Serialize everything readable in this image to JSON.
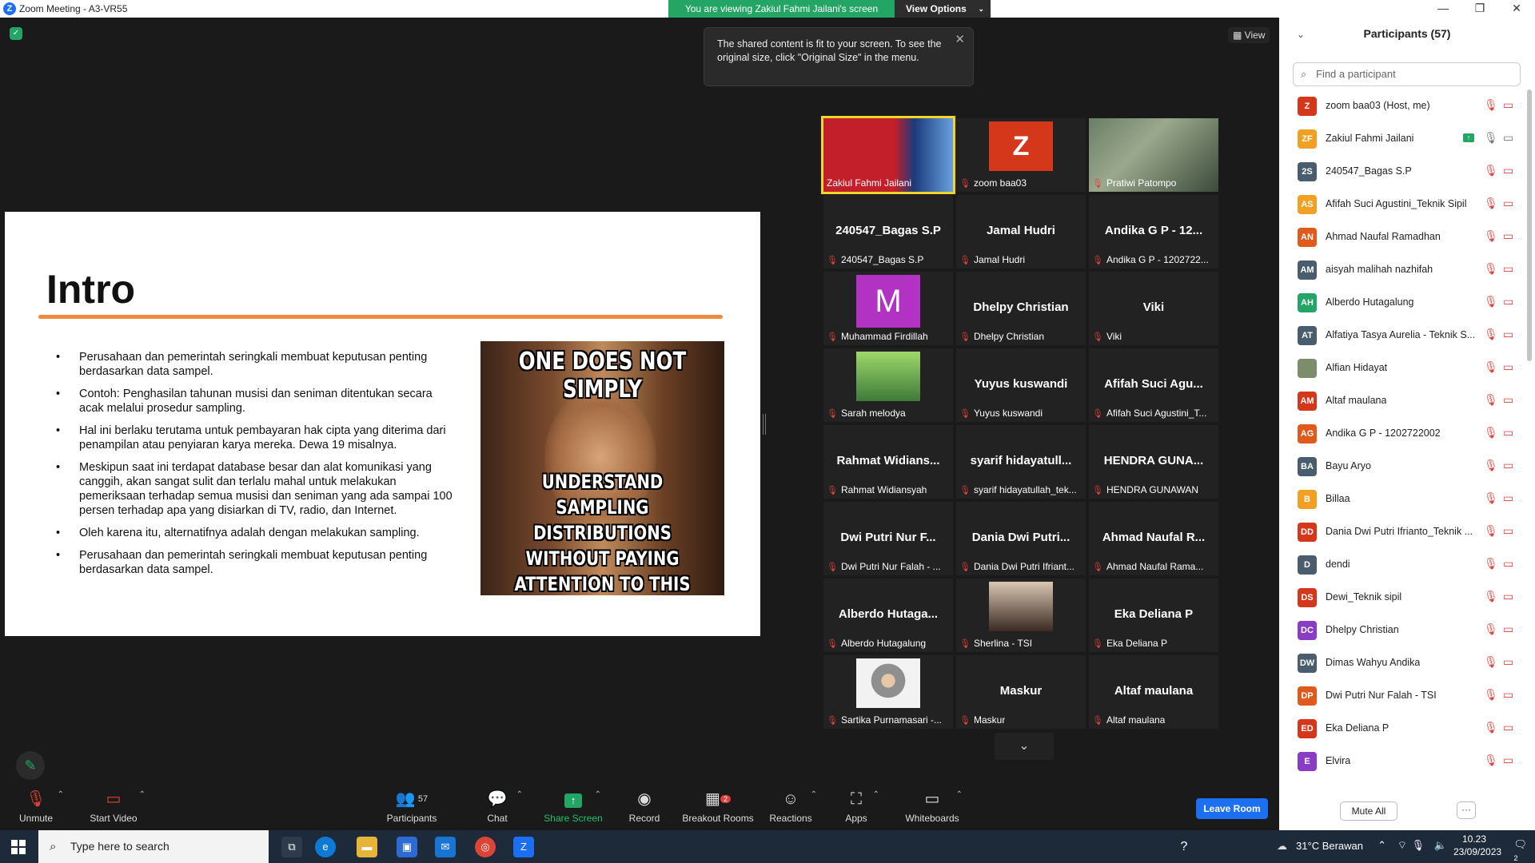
{
  "window": {
    "title": "Zoom Meeting - A3-VR55",
    "logo": "Z"
  },
  "banner": {
    "viewing": "You are viewing Zakiul Fahmi Jailani's screen",
    "view_options": "View Options"
  },
  "tooltip": {
    "text": "The shared content is fit to your screen. To see the original size, click \"Original Size\" in the menu."
  },
  "view_button": "View",
  "slide": {
    "title": "Intro",
    "bullets": [
      "Perusahaan dan pemerintah seringkali membuat keputusan penting berdasarkan data sampel.",
      "Contoh: Penghasilan tahunan musisi dan seniman ditentukan secara acak melalui prosedur sampling.",
      "Hal ini berlaku terutama untuk pembayaran hak cipta yang diterima dari penampilan atau penyiaran karya mereka. Dewa 19 misalnya.",
      "Meskipun saat ini terdapat database besar dan alat komunikasi yang canggih, akan sangat sulit dan terlalu mahal untuk melakukan pemeriksaan terhadap semua musisi dan seniman yang ada sampai 100 persen terhadap apa yang disiarkan di TV, radio, dan Internet.",
      "Oleh karena itu, alternatifnya adalah dengan melakukan sampling.",
      "Perusahaan dan pemerintah seringkali membuat keputusan penting berdasarkan data sampel."
    ],
    "meme_top": "ONE DOES NOT SIMPLY",
    "meme_bottom": "UNDERSTAND SAMPLING DISTRIBUTIONS WITHOUT PAYING ATTENTION TO THIS PRESENTATION"
  },
  "tiles": [
    {
      "big": "",
      "label": "Zakiul Fahmi Jailani",
      "kind": "video-slide",
      "active": true,
      "muted": false
    },
    {
      "big": "",
      "label": "zoom baa03",
      "kind": "avatar-z",
      "muted": true
    },
    {
      "big": "",
      "label": "Pratiwi Patompo",
      "kind": "video-person",
      "muted": true
    },
    {
      "big": "240547_Bagas S.P",
      "label": "240547_Bagas S.P",
      "muted": true
    },
    {
      "big": "Jamal Hudri",
      "label": "Jamal Hudri",
      "muted": true
    },
    {
      "big": "Andika G P - 12...",
      "label": "Andika G P - 1202722...",
      "muted": true
    },
    {
      "big": "",
      "label": "Muhammad Firdillah",
      "kind": "avatar-m",
      "muted": true
    },
    {
      "big": "Dhelpy Christian",
      "label": "Dhelpy Christian",
      "muted": true
    },
    {
      "big": "Viki",
      "label": "Viki",
      "muted": true
    },
    {
      "big": "",
      "label": "Sarah melodya",
      "kind": "photo-green",
      "muted": true
    },
    {
      "big": "Yuyus kuswandi",
      "label": "Yuyus kuswandi",
      "muted": true
    },
    {
      "big": "Afifah Suci Agu...",
      "label": "Afifah Suci Agustini_T...",
      "muted": true
    },
    {
      "big": "Rahmat Widians...",
      "label": "Rahmat Widiansyah",
      "muted": true
    },
    {
      "big": "syarif hidayatull...",
      "label": "syarif hidayatullah_tek...",
      "muted": true
    },
    {
      "big": "HENDRA GUNA...",
      "label": "HENDRA GUNAWAN",
      "muted": true
    },
    {
      "big": "Dwi Putri Nur F...",
      "label": "Dwi Putri Nur Falah - ...",
      "muted": true
    },
    {
      "big": "Dania Dwi Putri...",
      "label": "Dania Dwi Putri Ifriant...",
      "muted": true
    },
    {
      "big": "Ahmad Naufal R...",
      "label": "Ahmad Naufal Rama...",
      "muted": true
    },
    {
      "big": "Alberdo Hutaga...",
      "label": "Alberdo Hutagalung",
      "muted": true
    },
    {
      "big": "",
      "label": "Sherlina - TSI",
      "kind": "photo-girl",
      "muted": true
    },
    {
      "big": "Eka Deliana P",
      "label": "Eka Deliana P",
      "muted": true
    },
    {
      "big": "",
      "label": "Sartika Purnamasari -...",
      "kind": "photo-hijab",
      "muted": true
    },
    {
      "big": "Maskur",
      "label": "Maskur",
      "muted": true
    },
    {
      "big": "Altaf maulana",
      "label": "Altaf maulana",
      "muted": true
    }
  ],
  "toolbar": {
    "unmute": "Unmute",
    "start_video": "Start Video",
    "participants": "Participants",
    "participants_count": "57",
    "chat": "Chat",
    "share_screen": "Share Screen",
    "record": "Record",
    "breakout": "Breakout Rooms",
    "breakout_badge": "2",
    "reactions": "Reactions",
    "apps": "Apps",
    "whiteboards": "Whiteboards",
    "leave": "Leave Room"
  },
  "panel": {
    "header": "Participants (57)",
    "search_placeholder": "Find a participant",
    "mute_all": "Mute All",
    "more": "···",
    "participants": [
      {
        "initials": "Z",
        "name": "zoom baa03 (Host, me)",
        "color": "#d5371b"
      },
      {
        "initials": "ZF",
        "name": "Zakiul Fahmi Jailani",
        "color": "#f2a024",
        "sharing": true
      },
      {
        "initials": "2S",
        "name": "240547_Bagas S.P",
        "color": "#4a5d6e"
      },
      {
        "initials": "AS",
        "name": "Afifah Suci Agustini_Teknik Sipil",
        "color": "#f2a024"
      },
      {
        "initials": "AN",
        "name": "Ahmad Naufal Ramadhan",
        "color": "#e05a1c"
      },
      {
        "initials": "AM",
        "name": "aisyah malihah nazhifah",
        "color": "#4a5d6e"
      },
      {
        "initials": "AH",
        "name": "Alberdo Hutagalung",
        "color": "#23a566"
      },
      {
        "initials": "AT",
        "name": "Alfatiya Tasya Aurelia - Teknik S...",
        "color": "#4a5d6e"
      },
      {
        "initials": "",
        "name": "Alfian Hidayat",
        "color": "#7d8c6a"
      },
      {
        "initials": "AM",
        "name": "Altaf maulana",
        "color": "#d5371b"
      },
      {
        "initials": "AG",
        "name": "Andika G P - 1202722002",
        "color": "#e05a1c"
      },
      {
        "initials": "BA",
        "name": "Bayu Aryo",
        "color": "#4a5d6e"
      },
      {
        "initials": "B",
        "name": "Billaa",
        "color": "#f2a024"
      },
      {
        "initials": "DD",
        "name": "Dania Dwi Putri Ifrianto_Teknik ...",
        "color": "#d5371b"
      },
      {
        "initials": "D",
        "name": "dendi",
        "color": "#4a5d6e"
      },
      {
        "initials": "DS",
        "name": "Dewi_Teknik sipil",
        "color": "#d5371b"
      },
      {
        "initials": "DC",
        "name": "Dhelpy Christian",
        "color": "#8a3cc4"
      },
      {
        "initials": "DW",
        "name": "Dimas Wahyu Andika",
        "color": "#4a5d6e"
      },
      {
        "initials": "DP",
        "name": "Dwi Putri Nur Falah - TSI",
        "color": "#e05a1c"
      },
      {
        "initials": "ED",
        "name": "Eka Deliana P",
        "color": "#d5371b"
      },
      {
        "initials": "E",
        "name": "Elvira",
        "color": "#8a3cc4"
      }
    ]
  },
  "taskbar": {
    "search": "Type here to search",
    "weather": "31°C  Berawan",
    "time": "10.23",
    "date": "23/09/2023",
    "notif": "2"
  }
}
